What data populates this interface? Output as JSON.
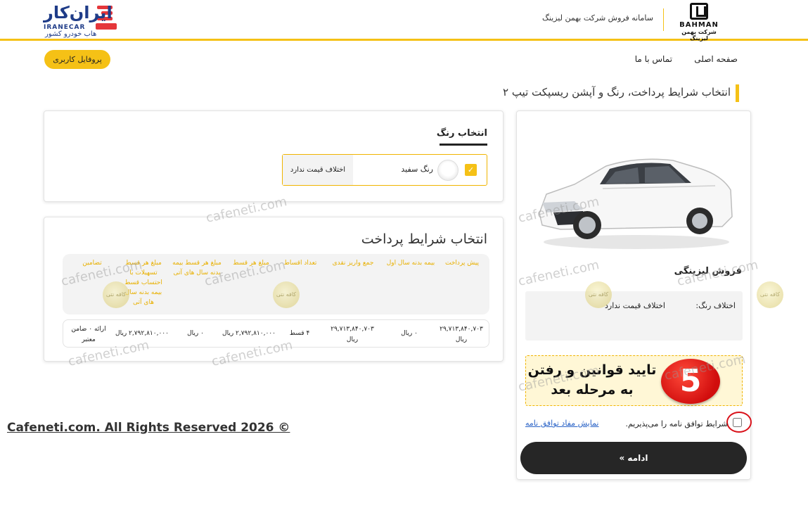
{
  "header": {
    "brand_en": "BAHMAN",
    "brand_fa": "شرکت بهمن لیزینگ",
    "title": "سامانه فروش شرکت بهمن لیزینگ",
    "partner_logo_fa": "ایران‌کار",
    "partner_logo_en": "IRANECAR",
    "partner_tagline": "هاب خودرو کشور"
  },
  "nav": {
    "home": "صفحه اصلی",
    "contact": "تماس با ما",
    "profile": "پروفایل کاربری"
  },
  "page": {
    "title": "انتخاب شرایط پرداخت، رنگ و آپشن ریسپکت تیپ ۲"
  },
  "sale": {
    "title": "فروش لیزینگی",
    "color_diff_label": "اختلاف رنگ:",
    "color_diff_value": "اختلاف قیمت ندارد",
    "banner_text": "تایید قوانین و رفتن به مرحله بعد",
    "banner_step": "5",
    "terms_text": "شرایط توافق نامه را می‌پذیریم.",
    "terms_link": "نمایش مفاد توافق نامه",
    "continue": "ادامه »"
  },
  "color": {
    "title": "انتخاب رنگ",
    "option_name": "رنگ سفید",
    "option_price": "اختلاف قیمت ندارد",
    "check": "✓"
  },
  "payment": {
    "title": "انتخاب شرایط پرداخت",
    "headers": [
      "پیش پرداخت",
      "بیمه بدنه سال اول",
      "جمع واریز نقدی",
      "تعداد اقساط",
      "مبلغ هر قسط",
      "مبلغ هر قسط بیمه بدنه سال های آتی",
      "مبلغ هر قسط تسهیلات با احتساب قسط بیمه بدنه سال های آتی",
      "تضامین"
    ],
    "row": [
      "۲۹,۷۱۳,۸۴۰,۷۰۳ ریال",
      "۰ ریال",
      "۲۹,۷۱۳,۸۴۰,۷۰۳ ریال",
      "۴ قسط",
      "۲,۷۹۲,۸۱۰,۰۰۰ ریال",
      "۰ ریال",
      "۲,۷۹۲,۸۱۰,۰۰۰ ریال",
      "ارائه ۰ ضامن معتبر"
    ]
  },
  "watermark": {
    "text": "cafeneti.com",
    "coin": "کافه نتی"
  },
  "footer": {
    "text": "Cafeneti.com. All Rights Reserved 2026 ©"
  },
  "colors": {
    "accent": "#f5c116",
    "dark_button": "#262626",
    "link": "#2a63c7",
    "step_red": "#d10d0d"
  }
}
